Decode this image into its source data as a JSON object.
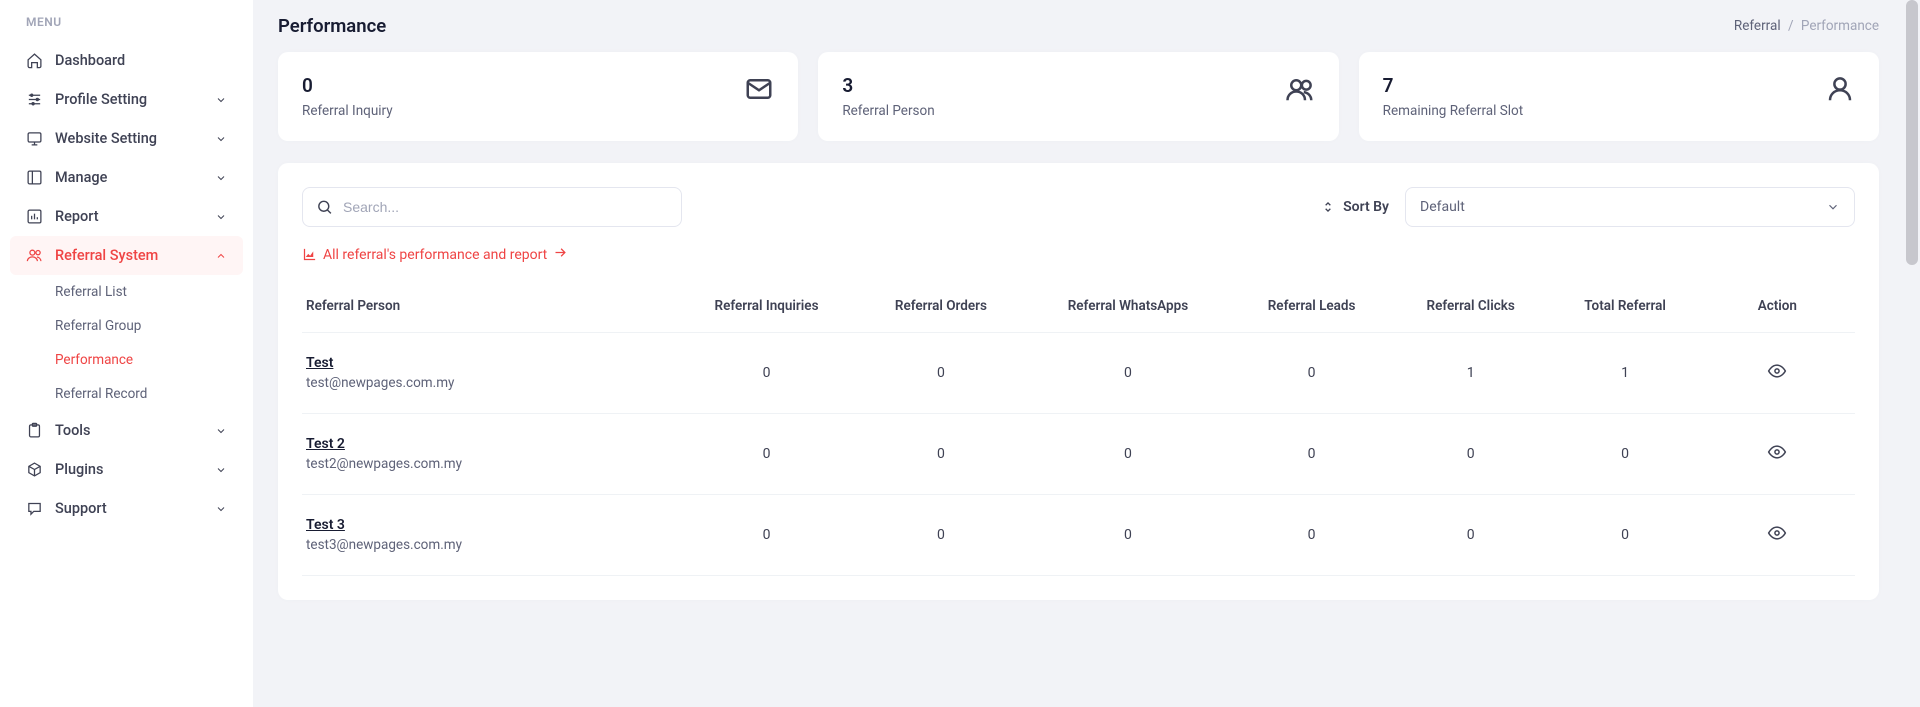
{
  "sidebar": {
    "heading": "MENU",
    "items": [
      {
        "label": "Dashboard",
        "icon": "home"
      },
      {
        "label": "Profile Setting",
        "icon": "sliders",
        "expandable": true
      },
      {
        "label": "Website Setting",
        "icon": "monitor",
        "expandable": true
      },
      {
        "label": "Manage",
        "icon": "layout",
        "expandable": true
      },
      {
        "label": "Report",
        "icon": "bar",
        "expandable": true
      },
      {
        "label": "Referral System",
        "icon": "users",
        "expandable": true,
        "active": true
      },
      {
        "label": "Tools",
        "icon": "clipboard",
        "expandable": true
      },
      {
        "label": "Plugins",
        "icon": "package",
        "expandable": true
      },
      {
        "label": "Support",
        "icon": "message",
        "expandable": true
      }
    ],
    "referral_sub": [
      {
        "label": "Referral List"
      },
      {
        "label": "Referral Group"
      },
      {
        "label": "Performance",
        "active": true
      },
      {
        "label": "Referral Record"
      }
    ]
  },
  "header": {
    "title": "Performance",
    "breadcrumb_first": "Referral",
    "breadcrumb_last": "Performance"
  },
  "stats": [
    {
      "value": "0",
      "label": "Referral Inquiry",
      "icon": "mail",
      "color": "#0d6efd"
    },
    {
      "value": "3",
      "label": "Referral Person",
      "icon": "users2",
      "color": "#f59e0b"
    },
    {
      "value": "7",
      "label": "Remaining Referral Slot",
      "icon": "user",
      "color": "#8b5cf6"
    }
  ],
  "toolbar": {
    "search_placeholder": "Search...",
    "sort_label": "Sort By",
    "sort_value": "Default",
    "report_link": "All referral's performance and report"
  },
  "table": {
    "headers": {
      "person": "Referral Person",
      "inquiries": "Referral Inquiries",
      "orders": "Referral Orders",
      "whatsapps": "Referral WhatsApps",
      "leads": "Referral Leads",
      "clicks": "Referral Clicks",
      "total": "Total Referral",
      "action": "Action"
    },
    "rows": [
      {
        "name": "Test",
        "email": "test@newpages.com.my",
        "inquiries": "0",
        "orders": "0",
        "whatsapps": "0",
        "leads": "0",
        "clicks": "1",
        "total": "1"
      },
      {
        "name": "Test 2",
        "email": "test2@newpages.com.my",
        "inquiries": "0",
        "orders": "0",
        "whatsapps": "0",
        "leads": "0",
        "clicks": "0",
        "total": "0"
      },
      {
        "name": "Test 3",
        "email": "test3@newpages.com.my",
        "inquiries": "0",
        "orders": "0",
        "whatsapps": "0",
        "leads": "0",
        "clicks": "0",
        "total": "0"
      }
    ]
  }
}
